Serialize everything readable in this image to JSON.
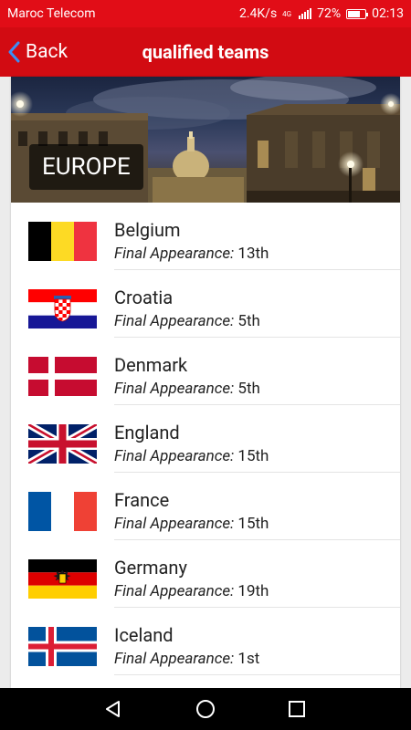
{
  "status_bar": {
    "carrier": "Maroc Telecom",
    "speed": "2.4K/s",
    "network": "4G",
    "battery": "72%",
    "battery_level": 0.72,
    "time": "02:13"
  },
  "app_bar": {
    "back_label": "Back",
    "title": "qualified teams"
  },
  "region": {
    "label": "EUROPE"
  },
  "appearance_label": "Final Appearance:",
  "teams": [
    {
      "name": "Belgium",
      "appearance": "13th",
      "flag": "belgium-flag"
    },
    {
      "name": "Croatia",
      "appearance": "5th",
      "flag": "croatia-flag"
    },
    {
      "name": "Denmark",
      "appearance": "5th",
      "flag": "denmark-flag"
    },
    {
      "name": "England",
      "appearance": "15th",
      "flag": "england-flag"
    },
    {
      "name": "France",
      "appearance": "15th",
      "flag": "france-flag"
    },
    {
      "name": "Germany",
      "appearance": "19th",
      "flag": "germany-flag"
    },
    {
      "name": "Iceland",
      "appearance": "1st",
      "flag": "iceland-flag"
    }
  ],
  "nav_bar": {
    "back_icon": "triangle-back-icon",
    "home_icon": "circle-home-icon",
    "recents_icon": "square-recents-icon"
  }
}
